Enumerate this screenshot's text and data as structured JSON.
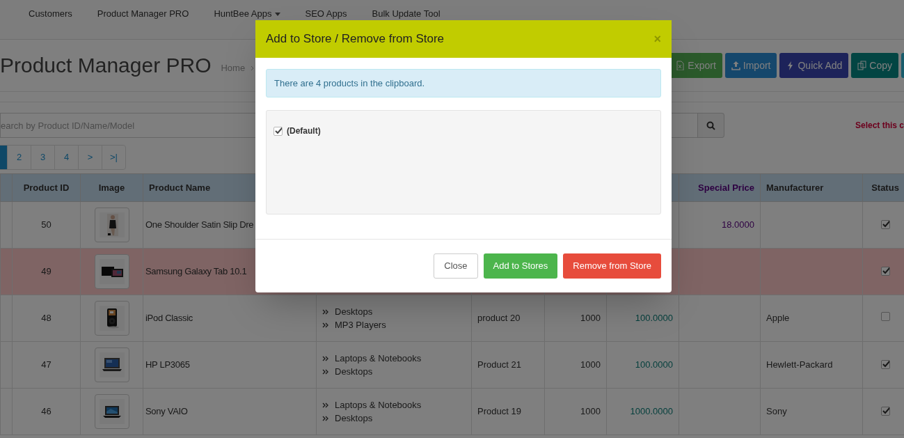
{
  "nav": [
    {
      "label": "Customers",
      "dropdown": false
    },
    {
      "label": "Product Manager PRO",
      "dropdown": false
    },
    {
      "label": "HuntBee Apps",
      "dropdown": true
    },
    {
      "label": "SEO Apps",
      "dropdown": false
    },
    {
      "label": "Bulk Update Tool",
      "dropdown": false
    }
  ],
  "page_title": "Product Manager PRO",
  "breadcrumb": [
    "Home"
  ],
  "toolbar": [
    {
      "label": "Export"
    },
    {
      "label": "Import"
    },
    {
      "label": "Quick Add"
    },
    {
      "label": "Copy"
    }
  ],
  "search": {
    "placeholder": "earch by Product ID/Name/Model"
  },
  "notice": "Select this c",
  "pagination": [
    {
      "selected": true
    },
    {
      "label": "2",
      "selected": false
    },
    {
      "label": "3",
      "selected": false
    },
    {
      "label": "4",
      "selected": false
    },
    {
      "label": ">",
      "selected": false
    },
    {
      "label": ">|",
      "selected": false
    }
  ],
  "table": {
    "columns": [
      "Product ID",
      "Image",
      "Product Name",
      "Special Price",
      "Manufacturer",
      "Status"
    ],
    "rows": [
      {
        "id": "50",
        "name": "One Shoulder Satin Slip Dre",
        "special_price": "18.0000",
        "status": true,
        "highlighted": false
      },
      {
        "id": "49",
        "name": "Samsung Galaxy Tab 10.1",
        "status": true,
        "highlighted": true
      },
      {
        "id": "48",
        "name": "iPod Classic",
        "categories": [
          "Desktops",
          "MP3 Players"
        ],
        "model": "product 20",
        "quantity": "1000",
        "price": "100.0000",
        "manufacturer": "Apple",
        "status": false,
        "highlighted": false
      },
      {
        "id": "47",
        "name": "HP LP3065",
        "categories": [
          "Laptops & Notebooks",
          "Desktops"
        ],
        "model": "Product 21",
        "quantity": "1000",
        "price": "100.0000",
        "manufacturer": "Hewlett-Packard",
        "status": true,
        "highlighted": false
      },
      {
        "id": "46",
        "name": "Sony VAIO",
        "categories": [
          "Laptops & Notebooks",
          "Desktops"
        ],
        "model": "Product 19",
        "quantity": "1000",
        "price": "1000.0000",
        "manufacturer": "Sony",
        "status": true,
        "highlighted": false
      }
    ]
  },
  "modal": {
    "title": "Add to Store / Remove from Store",
    "close": "×",
    "info": "There are 4 products in the clipboard.",
    "stores": [
      {
        "label": "(Default)",
        "checked": true
      }
    ],
    "buttons": [
      {
        "label": "Close",
        "kind": "default"
      },
      {
        "label": "Add to Stores",
        "kind": "success"
      },
      {
        "label": "Remove from Store",
        "kind": "danger"
      }
    ]
  }
}
